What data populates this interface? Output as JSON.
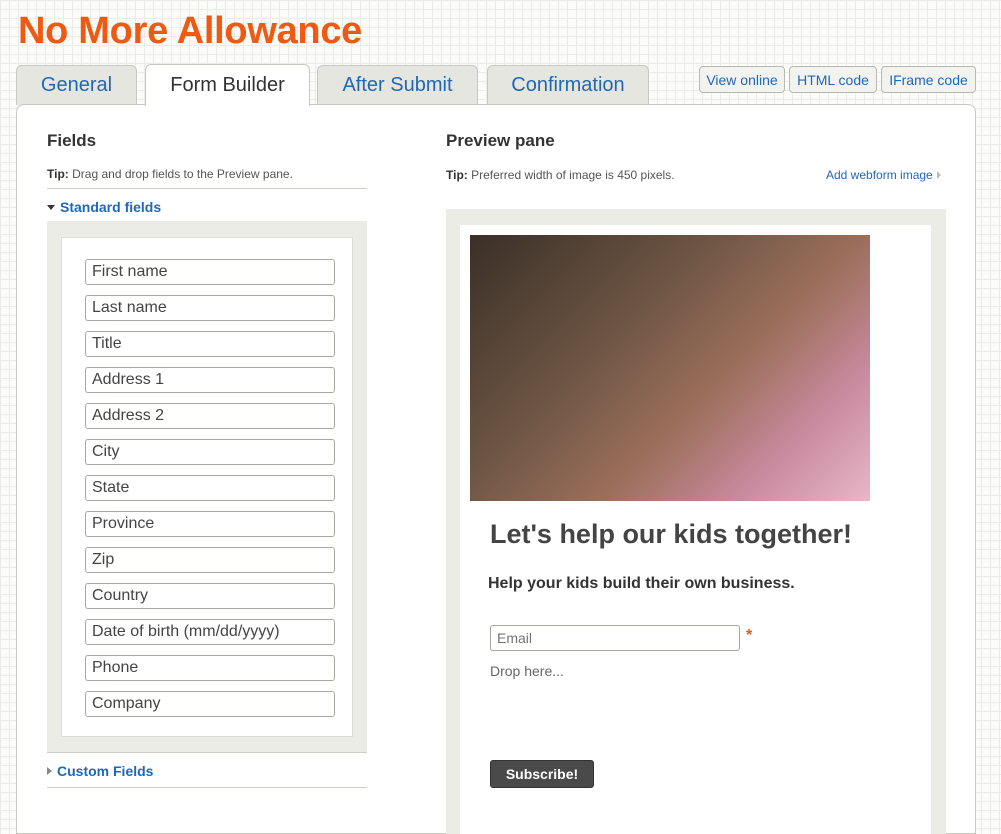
{
  "app": {
    "title": "No More Allowance"
  },
  "tabs": [
    {
      "label": "General"
    },
    {
      "label": "Form Builder"
    },
    {
      "label": "After Submit"
    },
    {
      "label": "Confirmation"
    }
  ],
  "actions": {
    "view_online": "View online",
    "html_code": "HTML code",
    "iframe_code": "IFrame code"
  },
  "fields_panel": {
    "heading": "Fields",
    "tip_label": "Tip:",
    "tip_text": "Drag and drop fields to the Preview pane.",
    "standard_section": "Standard fields",
    "custom_section": "Custom Fields",
    "items": [
      "First name",
      "Last name",
      "Title",
      "Address 1",
      "Address 2",
      "City",
      "State",
      "Province",
      "Zip",
      "Country",
      "Date of birth (mm/dd/yyyy)",
      "Phone",
      "Company"
    ]
  },
  "preview": {
    "heading": "Preview pane",
    "tip_label": "Tip:",
    "tip_text": "Preferred width of image is 450 pixels.",
    "add_image": "Add webform image",
    "form_title": "Let's help our kids together!",
    "form_subtitle": "Help your kids build their own business.",
    "email_placeholder": "Email",
    "required_mark": "*",
    "drop_here": "Drop here...",
    "subscribe": "Subscribe!"
  },
  "colors": {
    "brand": "#ee5a12",
    "link": "#1f68b8",
    "panel_bg": "#ecece7"
  }
}
